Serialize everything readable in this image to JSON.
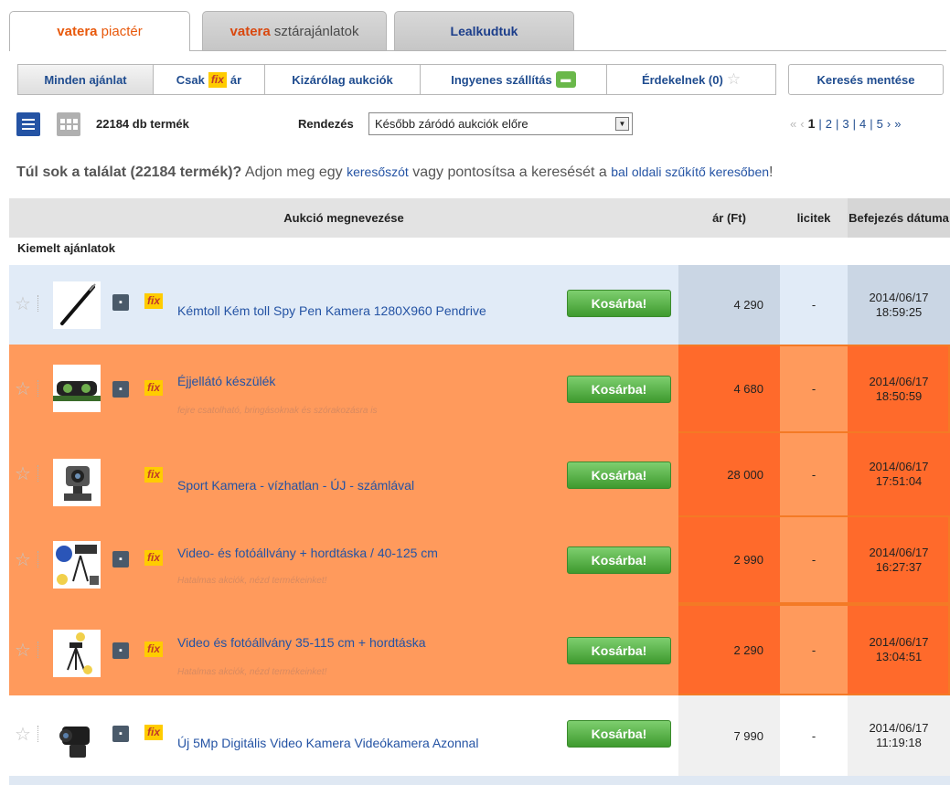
{
  "tabs": {
    "marketplace": {
      "brand": "vatera",
      "rest": "piactér"
    },
    "star": {
      "brand": "vatera",
      "rest": "sztárajánlatok"
    },
    "deals": {
      "label": "Lealkudtuk"
    }
  },
  "filters": {
    "all": "Minden ajánlat",
    "only_prefix": "Csak",
    "fix": "fix",
    "only_suffix": "ár",
    "auctions": "Kizárólag aukciók",
    "free_shipping": "Ingyenes szállítás",
    "interested": "Érdekelnek (0)",
    "save_search": "Keresés mentése"
  },
  "toolbar": {
    "count": "22184 db termék",
    "sort_label": "Rendezés",
    "sort_value": "Később záródó aukciók előre",
    "pager": {
      "first": "«",
      "prev": "‹",
      "pages": [
        "1",
        "2",
        "3",
        "4",
        "5"
      ],
      "next": "›",
      "last": "»"
    }
  },
  "hint": {
    "bold": "Túl sok a találat (22184 termék)?",
    "text1": " Adjon meg egy ",
    "link1": "keresőszót",
    "text2": " vagy pontosítsa a keresését a ",
    "link2": "bal oldali szűkítő keresőben",
    "text3": "!"
  },
  "table": {
    "headers": {
      "name": "Aukció megnevezése",
      "price": "ár (Ft)",
      "bids": "licitek",
      "date": "Befejezés dátuma"
    },
    "section": "Kiemelt ajánlatok",
    "cart_label": "Kosárba!",
    "fix_label": "fix",
    "rows": [
      {
        "title": "Kémtoll Kém toll Spy Pen Kamera 1280X960 Pendrive",
        "subtitle": "",
        "price": "4 290",
        "bids": "-",
        "date": "2014/06/17",
        "time": "18:59:25",
        "style": "blue"
      },
      {
        "title": "Éjjellátó készülék",
        "subtitle": "fejre csatolható, bringásoknak és szórakozásra is",
        "price": "4 680",
        "bids": "-",
        "date": "2014/06/17",
        "time": "18:50:59",
        "style": "orange"
      },
      {
        "title": "Sport Kamera - vízhatlan - ÚJ - számlával",
        "subtitle": "",
        "price": "28 000",
        "bids": "-",
        "date": "2014/06/17",
        "time": "17:51:04",
        "style": "orange"
      },
      {
        "title": "Video- és fotóállvány + hordtáska / 40-125 cm",
        "subtitle": "Hatalmas akciók, nézd termékeinket!",
        "price": "2 990",
        "bids": "-",
        "date": "2014/06/17",
        "time": "16:27:37",
        "style": "orange"
      },
      {
        "title": "Video és fotóállvány 35-115 cm + hordtáska",
        "subtitle": "Hatalmas akciók, nézd termékeinket!",
        "price": "2 290",
        "bids": "-",
        "date": "2014/06/17",
        "time": "13:04:51",
        "style": "orange"
      },
      {
        "title": "Új 5Mp Digitális Video Kamera Videókamera Azonnal",
        "subtitle": "",
        "price": "7 990",
        "bids": "-",
        "date": "2014/06/17",
        "time": "11:19:18",
        "style": "white"
      }
    ]
  },
  "colors": {
    "link": "#2453a4",
    "highlight": "#ff9a5c",
    "highlight_strong": "#ff6a2b",
    "brand": "#e8590c",
    "cart": "#4fae3e"
  }
}
